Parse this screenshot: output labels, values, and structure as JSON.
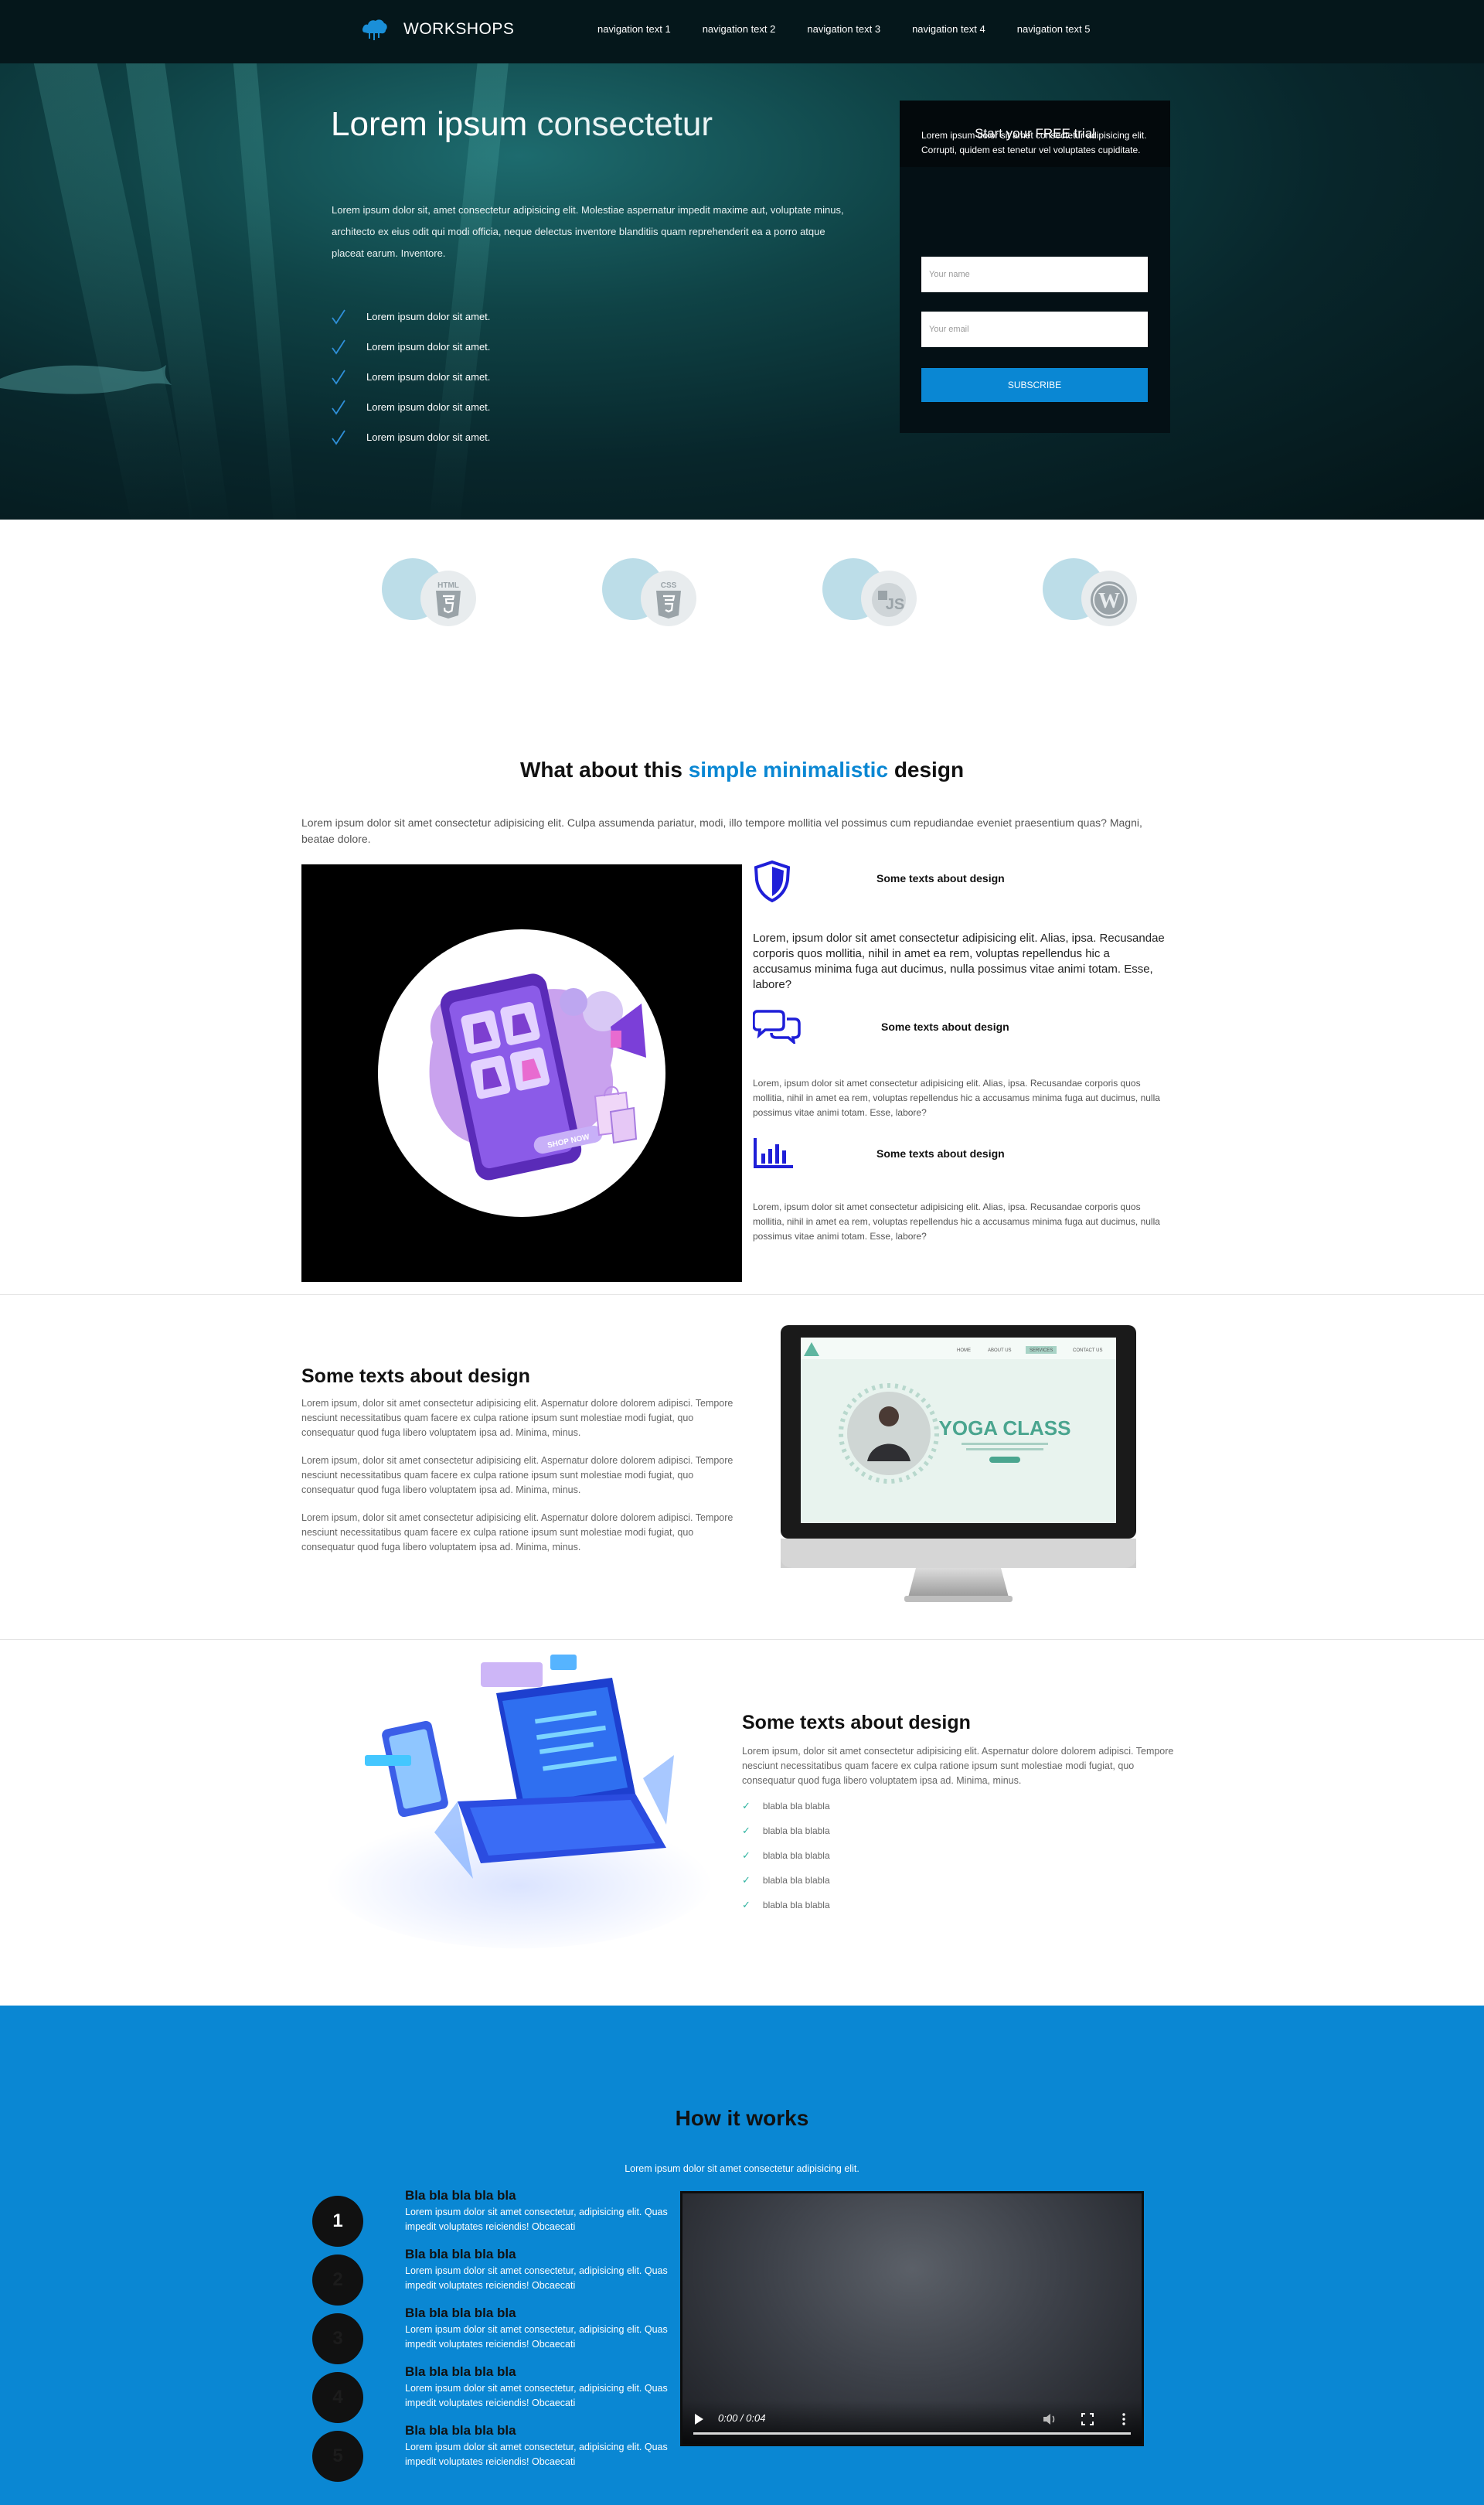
{
  "nav": {
    "brand": "WORKSHOPS",
    "logo_icon": "cloud-logo-icon",
    "links": [
      "navigation text 1",
      "navigation text 2",
      "navigation text 3",
      "navigation text 4",
      "navigation text 5"
    ]
  },
  "hero": {
    "title_main": "Lorem ipsum",
    "title_light": "consectetur",
    "text": "Lorem ipsum dolor sit, amet consectetur adipisicing elit. Molestiae aspernatur impedit maxime aut, voluptate minus, architecto ex eius odit qui modi officia, neque delectus inventore blanditiis quam reprehenderit ea a porro atque placeat earum. Inventore.",
    "checklist": [
      "Lorem ipsum dolor sit amet.",
      "Lorem ipsum dolor sit amet.",
      "Lorem ipsum dolor sit amet.",
      "Lorem ipsum dolor sit amet.",
      "Lorem ipsum dolor sit amet."
    ]
  },
  "signup": {
    "title": "Start your FREE trial",
    "text": "Lorem ipsum dolor sit amet consectetur adipisicing elit. Corrupti, quidem est tenetur vel voluptates cupiditate.",
    "name_placeholder": "Your name",
    "email_placeholder": "Your email",
    "button": "SUBSCRIBE"
  },
  "tech_logos": [
    {
      "name": "html5-icon",
      "label": "HTML"
    },
    {
      "name": "css3-icon",
      "label": "CSS"
    },
    {
      "name": "javascript-icon",
      "label": "JS"
    },
    {
      "name": "wordpress-icon",
      "label": "W"
    }
  ],
  "design": {
    "title_before": "What about this",
    "title_accent": "simple minimalistic",
    "title_after": "design",
    "intro": "Lorem ipsum dolor sit amet consectetur adipisicing elit. Culpa assumenda pariatur, modi, illo tempore mollitia vel possimus cum repudiandae eveniet praesentium quas? Magni, beatae dolore.",
    "phone_label": "SHOP NOW",
    "features": [
      {
        "icon": "shield-icon",
        "title": "Some texts about design",
        "text": "Lorem, ipsum dolor sit amet consectetur adipisicing elit. Alias, ipsa. Recusandae corporis quos mollitia, nihil in amet ea rem, voluptas repellendus hic a accusamus minima fuga aut ducimus, nulla possimus vitae animi totam. Esse, labore?"
      },
      {
        "icon": "chat-icon",
        "title": "Some texts about design",
        "text": "Lorem, ipsum dolor sit amet consectetur adipisicing elit. Alias, ipsa. Recusandae corporis quos mollitia, nihil in amet ea rem, voluptas repellendus hic a accusamus minima fuga aut ducimus, nulla possimus vitae animi totam. Esse, labore?"
      },
      {
        "icon": "bar-chart-icon",
        "title": "Some texts about design",
        "text": "Lorem, ipsum dolor sit amet consectetur adipisicing elit. Alias, ipsa. Recusandae corporis quos mollitia, nihil in amet ea rem, voluptas repellendus hic a accusamus minima fuga aut ducimus, nulla possimus vitae animi totam. Esse, labore?"
      }
    ]
  },
  "text_monitor": {
    "title": "Some texts about design",
    "paragraphs": [
      "Lorem ipsum, dolor sit amet consectetur adipisicing elit. Aspernatur dolore dolorem adipisci. Tempore nesciunt necessitatibus quam facere ex culpa ratione ipsum sunt molestiae modi fugiat, quo consequatur quod fuga libero voluptatem ipsa ad. Minima, minus.",
      "Lorem ipsum, dolor sit amet consectetur adipisicing elit. Aspernatur dolore dolorem adipisci. Tempore nesciunt necessitatibus quam facere ex culpa ratione ipsum sunt molestiae modi fugiat, quo consequatur quod fuga libero voluptatem ipsa ad. Minima, minus.",
      "Lorem ipsum, dolor sit amet consectetur adipisicing elit. Aspernatur dolore dolorem adipisci. Tempore nesciunt necessitatibus quam facere ex culpa ratione ipsum sunt molestiae modi fugiat, quo consequatur quod fuga libero voluptatem ipsa ad. Minima, minus."
    ],
    "screen_title": "YOGA CLASS",
    "screen_nav": [
      "HOME",
      "ABOUT US",
      "SERVICES",
      "CONTACT US"
    ]
  },
  "laptop_list": {
    "title": "Some texts about design",
    "text": "Lorem ipsum, dolor sit amet consectetur adipisicing elit. Aspernatur dolore dolorem adipisci. Tempore nesciunt necessitatibus quam facere ex culpa ratione ipsum sunt molestiae modi fugiat, quo consequatur quod fuga libero voluptatem ipsa ad. Minima, minus.",
    "items": [
      "blabla bla blabla",
      "blabla bla blabla",
      "blabla bla blabla",
      "blabla bla blabla",
      "blabla bla blabla"
    ]
  },
  "how": {
    "title": "How it works",
    "subtitle": "Lorem ipsum dolor sit amet consectetur adipisicing elit.",
    "steps": [
      {
        "num": "1",
        "title": "Bla bla bla bla bla",
        "text": "Lorem ipsum dolor sit amet consectetur, adipisicing elit. Quas impedit voluptates reiciendis! Obcaecati"
      },
      {
        "num": "2",
        "title": "Bla bla bla bla bla",
        "text": "Lorem ipsum dolor sit amet consectetur, adipisicing elit. Quas impedit voluptates reiciendis! Obcaecati"
      },
      {
        "num": "3",
        "title": "Bla bla bla bla bla",
        "text": "Lorem ipsum dolor sit amet consectetur, adipisicing elit. Quas impedit voluptates reiciendis! Obcaecati"
      },
      {
        "num": "4",
        "title": "Bla bla bla bla bla",
        "text": "Lorem ipsum dolor sit amet consectetur, adipisicing elit. Quas impedit voluptates reiciendis! Obcaecati"
      },
      {
        "num": "5",
        "title": "Bla bla bla bla bla",
        "text": "Lorem ipsum dolor sit amet consectetur, adipisicing elit. Quas impedit voluptates reiciendis! Obcaecati"
      }
    ],
    "video_time": "0:00 / 0:04"
  },
  "colors": {
    "accent": "#0a87d3",
    "nav_bg": "#05171b",
    "hero_bg": "#0f4346",
    "check": "#2fb3a0"
  }
}
